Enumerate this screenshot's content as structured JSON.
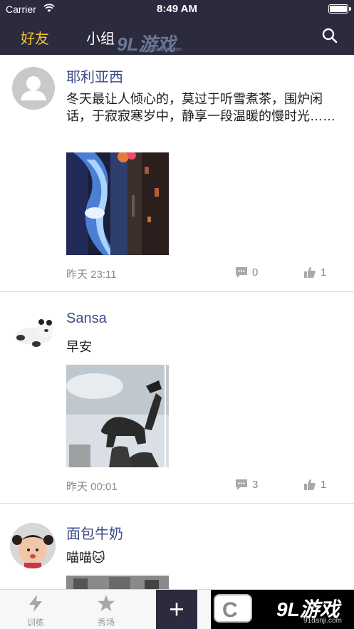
{
  "status_bar": {
    "carrier": "Carrier",
    "time": "8:49 AM"
  },
  "header": {
    "tabs": [
      {
        "label": "好友",
        "active": true
      },
      {
        "label": "小组",
        "active": false
      }
    ],
    "watermark": {
      "big": "9L游戏",
      "small": "91danji.com"
    },
    "search_icon": "search-icon"
  },
  "posts": [
    {
      "author": "耶利亚西",
      "text": "冬天最让人倾心的，莫过于听雪煮茶，围炉闲话，于寂寂寒岁中，静享一段温暖的慢时光……",
      "time": "昨天 23:11",
      "comments": "0",
      "likes": "1"
    },
    {
      "author": "Sansa",
      "text": "早安",
      "time": "昨天 00:01",
      "comments": "3",
      "likes": "1"
    },
    {
      "author": "面包牛奶",
      "text": "喵喵🐱"
    }
  ],
  "tabbar": {
    "items": [
      {
        "label": "训练",
        "icon": "lightning-icon"
      },
      {
        "label": "秀场",
        "icon": "star-icon"
      }
    ],
    "plus_icon": "plus-icon",
    "corner_logo": {
      "letter": "C",
      "big": "9L游戏",
      "small": "91danji.com"
    }
  },
  "colors": {
    "header_bg": "#2b2b3d",
    "active_tab": "#f4c430",
    "author": "#3d4a8a"
  }
}
